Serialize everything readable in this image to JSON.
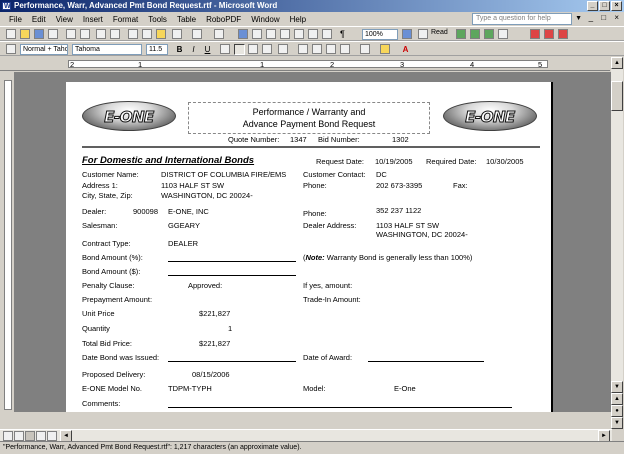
{
  "window": {
    "title": "Performance, Warr, Advanced Pmt Bond Request.rtf - Microsoft Word",
    "minimize": "_",
    "maximize": "□",
    "close": "×"
  },
  "menu": {
    "items": [
      "File",
      "Edit",
      "View",
      "Insert",
      "Format",
      "Tools",
      "Table",
      "RoboPDF",
      "Window",
      "Help"
    ],
    "help_placeholder": "Type a question for help"
  },
  "toolbar": {
    "zoom": "100%",
    "read_label": "Read",
    "pilcrow": "¶",
    "style": "Normal + Tahor",
    "font": "Tahoma",
    "font_size": "11.5",
    "bold": "B",
    "italic": "I",
    "underline": "U",
    "font_color_glyph": "A"
  },
  "ruler": {
    "numbers": [
      "2",
      "1",
      "1",
      "2",
      "3",
      "4",
      "5",
      "6"
    ]
  },
  "document": {
    "title_line1": "Performance / Warranty and",
    "title_line2": "Advance Payment Bond Request",
    "logo_text": "E-ONE",
    "quote_number_label": "Quote Number:",
    "quote_number": "1347",
    "bid_number_label": "Bid Number:",
    "bid_number": "1302",
    "section_heading": "For Domestic and International Bonds",
    "request_date_label": "Request Date:",
    "request_date": "10/19/2005",
    "required_date_label": "Required Date:",
    "required_date": "10/30/2005",
    "customer_name_label": "Customer Name:",
    "customer_name": "DISTRICT OF COLUMBIA FIRE/EMS",
    "customer_contact_label": "Customer Contact:",
    "customer_contact": "DC",
    "address_label": "Address 1:",
    "address": "1103 HALF ST SW",
    "city_label": "City, State, Zip:",
    "city": "WASHINGTON, DC 20024-",
    "phone_label": "Phone:",
    "phone": "202 673-3395",
    "fax_label": "Fax:",
    "dealer_label": "Dealer:",
    "dealer_code": "900098",
    "dealer_name": "E-ONE, INC",
    "dealer_phone_label": "Phone:",
    "dealer_phone": "352 237 1122",
    "salesman_label": "Salesman:",
    "salesman": "GGEARY",
    "dealer_address_label": "Dealer Address:",
    "dealer_address1": "1103 HALF ST SW",
    "dealer_address2": "WASHINGTON, DC 20024-",
    "contract_type_label": "Contract Type:",
    "contract_type": "DEALER",
    "bond_pct_label": "Bond Amount (%):",
    "note_prefix": "(",
    "note_label": "Note:",
    "note_text": " Warranty Bond is generally less than 100%)",
    "bond_amt_label": "Bond Amount ($):",
    "penalty_label": "Penalty Clause:",
    "penalty_value": "Approved:",
    "if_yes_label": "If yes, amount:",
    "prepayment_label": "Prepayment Amount:",
    "tradein_label": "Trade-In Amount:",
    "unit_price_label": "Unit Price",
    "unit_price": "$221,827",
    "quantity_label": "Quantity",
    "quantity": "1",
    "total_bid_label": "Total Bid Price:",
    "total_bid": "$221,827",
    "date_issued_label": "Date Bond was Issued:",
    "date_award_label": "Date of Award:",
    "proposed_delivery_label": "Proposed Delivery:",
    "proposed_delivery": "08/15/2006",
    "model_no_label": "E-ONE Model No.",
    "model_no": "TDPM-TYPH",
    "model_label": "Model:",
    "model": "E-One",
    "comments_label": "Comments:"
  },
  "status": {
    "text": "\"Performance, Warr, Advanced Pmt Bond Request.rtf\": 1,217 characters (an approximate value)."
  }
}
